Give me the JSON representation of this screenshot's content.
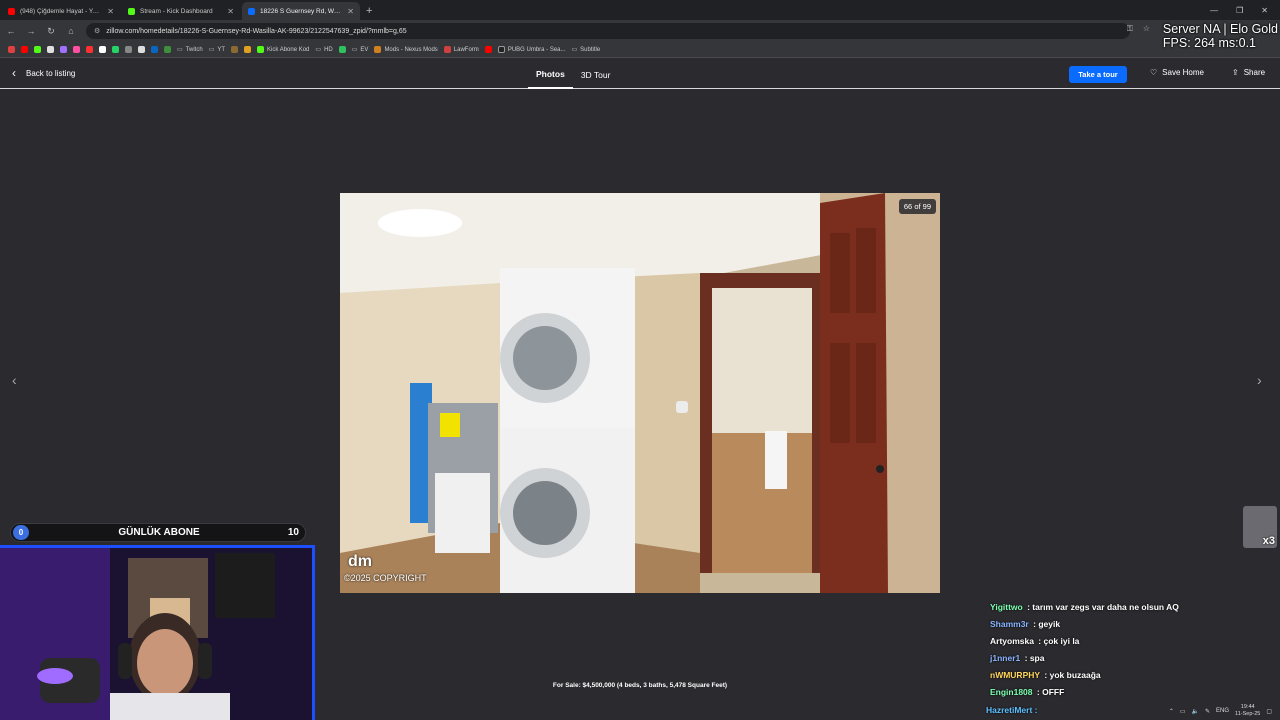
{
  "browser": {
    "tabs": [
      {
        "title": "(948) Çiğdemle Hayat - YouTube",
        "color": "#ff0000"
      },
      {
        "title": "Stream - Kick Dashboard",
        "color": "#53fc18"
      },
      {
        "title": "18226 S Guernsey Rd, Wasilla, AK",
        "color": "#0a6cff"
      }
    ],
    "url": "zillow.com/homedetails/18226-S-Guernsey-Rd-Wasilla-AK-99623/2122547639_zpid/?mmlb=g,65",
    "bookmarks": [
      "Twitch",
      "YT",
      "Kick Abone Kod",
      "HD",
      "EV",
      "Mods - Nexus Mods",
      "LawForm",
      "PUBG Umbra - Sea...",
      "Subtitle"
    ]
  },
  "overlay": {
    "line1": "Server NA | Elo Gold",
    "line2": "FPS: 264 ms:0.1"
  },
  "header": {
    "back_label": "Back to listing",
    "tabs": [
      "Photos",
      "3D Tour"
    ],
    "tour_button": "Take a tour",
    "save_label": "Save Home",
    "share_label": "Share"
  },
  "photo": {
    "counter": "66 of 99",
    "watermark": "©2025 COPYRIGHT",
    "logo": "dm",
    "caption": "For Sale: $4,500,000 (4 beds, 3 baths, 5,478 Square Feet)"
  },
  "subbar": {
    "current": "0",
    "label": "GÜNLÜK ABONE",
    "goal": "10"
  },
  "chat": [
    {
      "user": "Yigittwo",
      "color": "#7cffb0",
      "msg": "tarım var zegs var daha ne olsun AQ"
    },
    {
      "user": "Shamm3r",
      "color": "#8ab4ff",
      "msg": "geyik"
    },
    {
      "user": "Artyomska",
      "color": "#ffffff",
      "msg": "çok iyi la"
    },
    {
      "user": "j1nner1",
      "color": "#8ab4ff",
      "msg": "spa"
    },
    {
      "user": "nWMURPHY",
      "color": "#ffd65c",
      "msg": "yok buzaağa"
    },
    {
      "user": "Engin1808",
      "color": "#7cffb0",
      "msg": "OFFF"
    }
  ],
  "chat_last_user": "HazretiMert :",
  "side_thumb": "x3",
  "taskbar": {
    "lang": "ENG",
    "time": "19:44",
    "date": "11-Sep-25"
  }
}
